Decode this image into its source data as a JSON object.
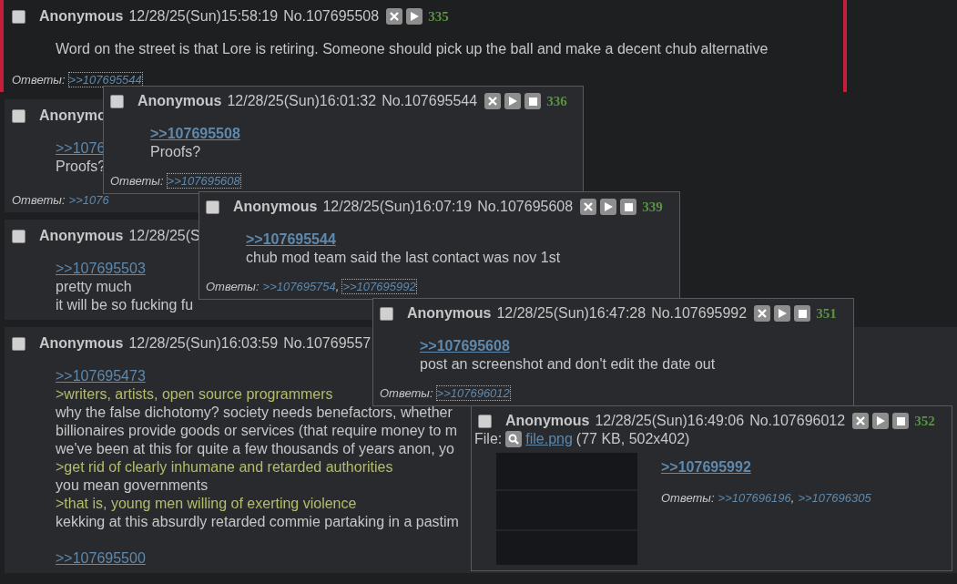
{
  "posts": [
    {
      "checked": false,
      "highlighted": true,
      "name": "Anonymous",
      "datetime": "12/28/25(Sun)15:58:19",
      "number": "No.107695508",
      "buttons": [
        {
          "kind": "close"
        },
        {
          "kind": "play"
        }
      ],
      "counter": "335",
      "body": [
        {
          "kind": "text",
          "text": "Word on the street is that Lore is retiring. Someone should pick up the ball and make a decent chub alternative"
        }
      ],
      "replies_label": "Ответы:",
      "replies": [
        {
          "text": ">>107695544",
          "selected": true
        }
      ]
    },
    {
      "checked": false,
      "highlighted": false,
      "name": "Anonymo",
      "body": [
        {
          "kind": "quotelink",
          "text": ">>1076",
          "selected": false
        },
        {
          "kind": "text",
          "text": "Proofs?"
        }
      ],
      "replies_label": "Ответы:",
      "replies": [
        {
          "text": ">>1076",
          "selected": false
        }
      ]
    },
    {
      "checked": false,
      "highlighted": false,
      "name": "Anonymous",
      "datetime": "12/28/25(S",
      "body": [
        {
          "kind": "quotelink",
          "text": ">>107695503",
          "selected": false
        },
        {
          "kind": "text",
          "text": "pretty much"
        },
        {
          "kind": "text",
          "text": "it will be so fucking fu"
        }
      ]
    },
    {
      "checked": false,
      "highlighted": false,
      "name": "Anonymous",
      "datetime": "12/28/25(Sun)16:03:59",
      "number": "No.10769557",
      "body": [
        {
          "kind": "quotelink",
          "text": ">>107695473",
          "selected": false
        },
        {
          "kind": "greentext",
          "text": ">writers, artists, open source programmers"
        },
        {
          "kind": "text",
          "text": "why the false dichotomy? society needs benefactors, whether"
        },
        {
          "kind": "text",
          "text": "billionaires provide goods or services (that require money to m"
        },
        {
          "kind": "text",
          "text": "we've been at this for quite a few thousands of years anon, yo"
        },
        {
          "kind": "greentext",
          "text": ">get rid of clearly inhumane and retarded authorities"
        },
        {
          "kind": "text",
          "text": "you mean governments"
        },
        {
          "kind": "greentext",
          "text": ">that is, young men willing of exerting violence"
        },
        {
          "kind": "text",
          "text": "kekking at this absurdly retarded commie partaking in a pastim"
        },
        {
          "kind": "blank"
        },
        {
          "kind": "quotelink",
          "text": ">>107695500",
          "selected": false
        }
      ]
    }
  ],
  "popups": [
    {
      "checked": false,
      "highlighted": false,
      "name": "Anonymous",
      "datetime": "12/28/25(Sun)16:01:32",
      "number": "No.107695544",
      "buttons": [
        {
          "kind": "close"
        },
        {
          "kind": "play"
        },
        {
          "kind": "stop"
        }
      ],
      "counter": "336",
      "body": [
        {
          "kind": "quotelink",
          "text": ">>107695508",
          "selected": true
        },
        {
          "kind": "text",
          "text": "Proofs?"
        }
      ],
      "replies_label": "Ответы:",
      "replies": [
        {
          "text": ">>107695608",
          "selected": true
        }
      ]
    },
    {
      "checked": false,
      "highlighted": false,
      "name": "Anonymous",
      "datetime": "12/28/25(Sun)16:07:19",
      "number": "No.107695608",
      "buttons": [
        {
          "kind": "close"
        },
        {
          "kind": "play"
        },
        {
          "kind": "stop"
        }
      ],
      "counter": "339",
      "body": [
        {
          "kind": "quotelink",
          "text": ">>107695544",
          "selected": true
        },
        {
          "kind": "text",
          "text": "chub mod team said the last contact was nov 1st"
        }
      ],
      "replies_label": "Ответы:",
      "replies": [
        {
          "text": ">>107695754",
          "separator": ",",
          "selected": false
        },
        {
          "text": ">>107695992",
          "selected": true
        }
      ]
    },
    {
      "checked": false,
      "highlighted": false,
      "name": "Anonymous",
      "datetime": "12/28/25(Sun)16:47:28",
      "number": "No.107695992",
      "buttons": [
        {
          "kind": "close"
        },
        {
          "kind": "play"
        },
        {
          "kind": "stop"
        }
      ],
      "counter": "351",
      "body": [
        {
          "kind": "quotelink",
          "text": ">>107695608",
          "selected": true
        },
        {
          "kind": "text",
          "text": "post an screenshot and don't edit the date out"
        }
      ],
      "replies_label": "Ответы:",
      "replies": [
        {
          "text": ">>107696012",
          "selected": true
        }
      ]
    },
    {
      "checked": false,
      "highlighted": false,
      "name": "Anonymous",
      "datetime": "12/28/25(Sun)16:49:06",
      "number": "No.107696012",
      "buttons": [
        {
          "kind": "close"
        },
        {
          "kind": "play"
        },
        {
          "kind": "stop"
        }
      ],
      "counter": "352",
      "file": {
        "label": "File:",
        "name": "file.png",
        "info": "(77 KB, 502x402)"
      },
      "body": [
        {
          "kind": "quotelink",
          "text": ">>107695992",
          "selected": true
        }
      ],
      "replies_label": "Ответы:",
      "replies": [
        {
          "text": ">>107696196",
          "separator": ",",
          "selected": false
        },
        {
          "text": ">>107696305",
          "selected": false
        }
      ]
    }
  ]
}
